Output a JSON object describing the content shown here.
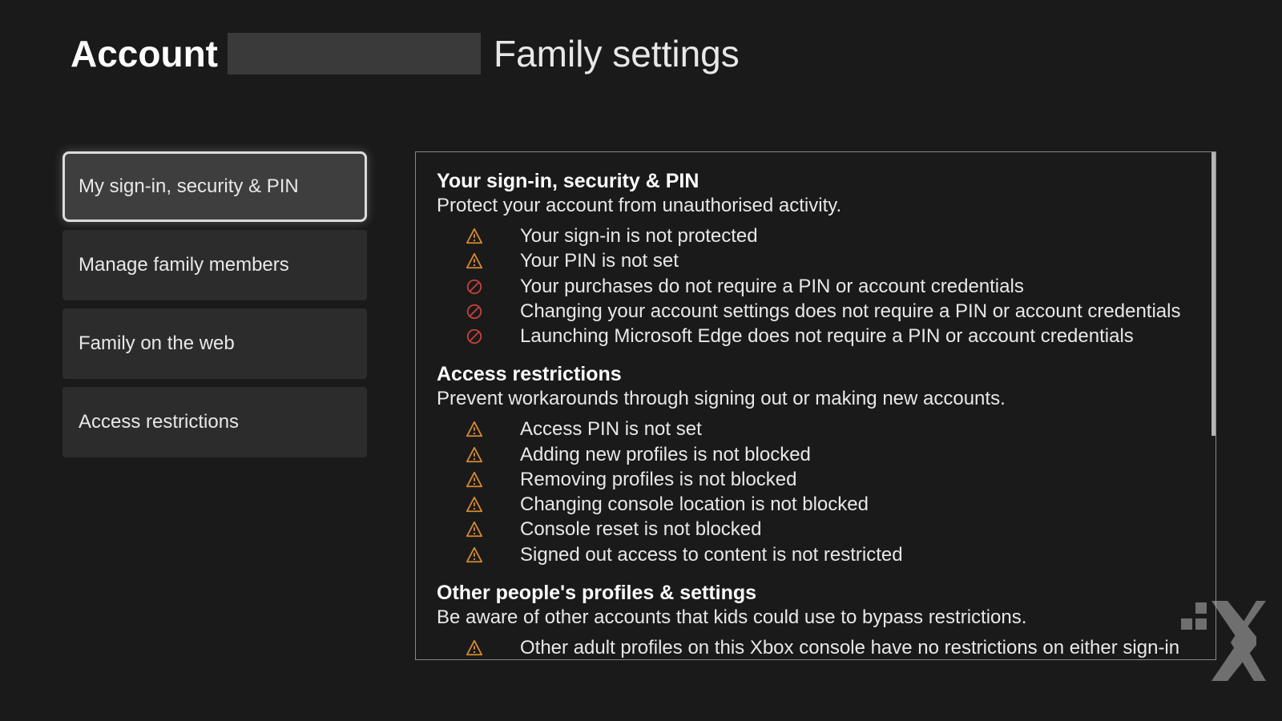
{
  "header": {
    "account_label": "Account",
    "section_label": "Family settings"
  },
  "sidebar": {
    "items": [
      {
        "label": "My sign-in, security & PIN",
        "selected": true
      },
      {
        "label": "Manage family members",
        "selected": false
      },
      {
        "label": "Family on the web",
        "selected": false
      },
      {
        "label": "Access restrictions",
        "selected": false
      }
    ]
  },
  "main": {
    "sections": [
      {
        "title": "Your sign-in, security & PIN",
        "subtitle": "Protect your account from unauthorised activity.",
        "items": [
          {
            "icon": "warning",
            "text": "Your sign-in is not protected"
          },
          {
            "icon": "warning",
            "text": "Your PIN is not set"
          },
          {
            "icon": "blocked",
            "text": "Your purchases do not require a PIN or account credentials"
          },
          {
            "icon": "blocked",
            "text": "Changing your account settings does not require a PIN or account credentials"
          },
          {
            "icon": "blocked",
            "text": "Launching Microsoft Edge does not require a PIN or account credentials"
          }
        ]
      },
      {
        "title": "Access restrictions",
        "subtitle": "Prevent workarounds through signing out or making new accounts.",
        "items": [
          {
            "icon": "warning",
            "text": "Access PIN is not set"
          },
          {
            "icon": "warning",
            "text": "Adding new profiles is not blocked"
          },
          {
            "icon": "warning",
            "text": "Removing profiles is not blocked"
          },
          {
            "icon": "warning",
            "text": "Changing console location is not blocked"
          },
          {
            "icon": "warning",
            "text": "Console reset is not blocked"
          },
          {
            "icon": "warning",
            "text": "Signed out access to content is not restricted"
          }
        ]
      },
      {
        "title": "Other people's profiles & settings",
        "subtitle": "Be aware of other accounts that kids could use to bypass restrictions.",
        "items": [
          {
            "icon": "warning",
            "text": "Other adult profiles on this Xbox console have no restrictions on either sign-in or access to content"
          }
        ]
      }
    ]
  },
  "colors": {
    "warning": "#d68a2e",
    "blocked": "#c3413e"
  }
}
